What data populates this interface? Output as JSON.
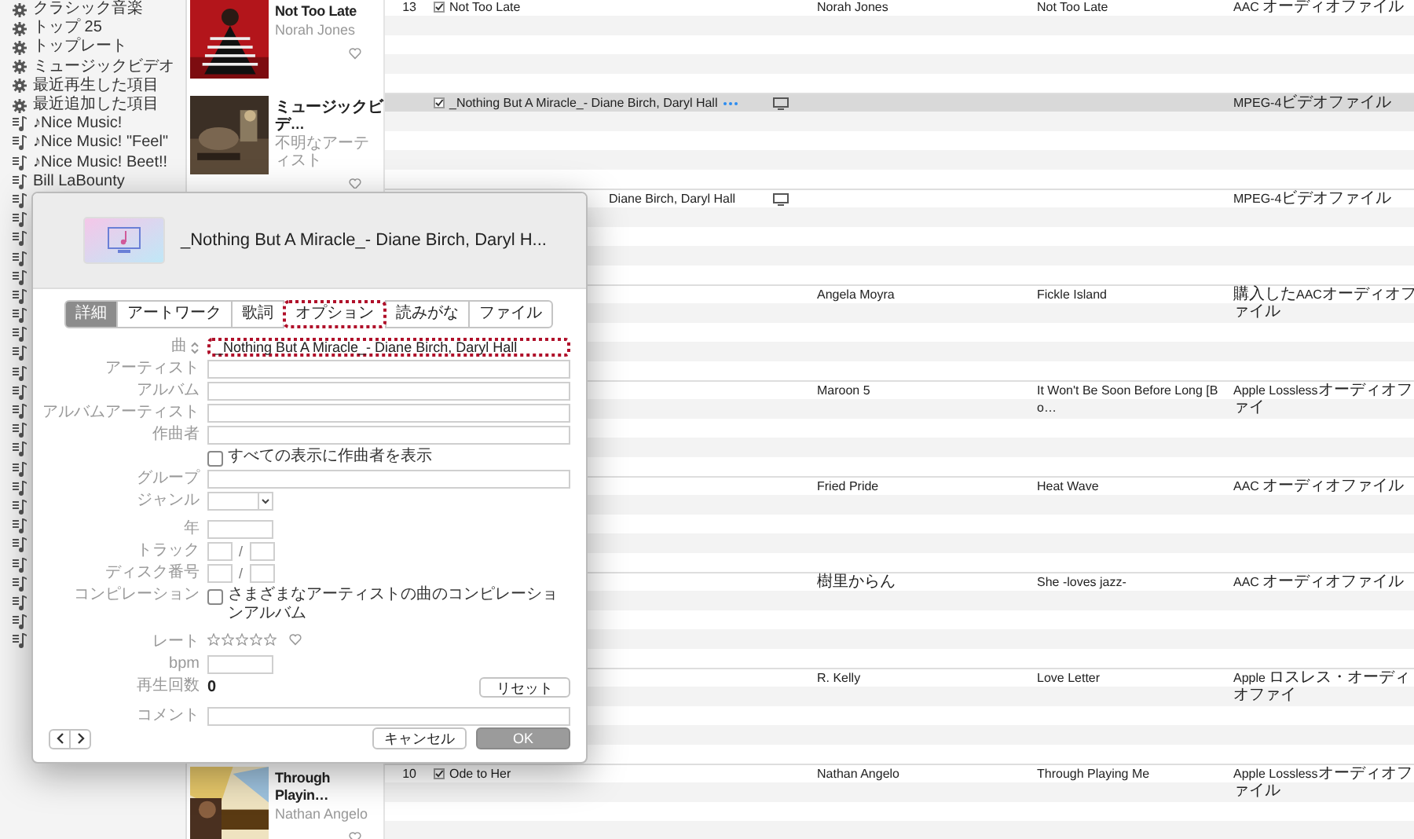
{
  "sidebar": {
    "items": [
      {
        "kind": "smart",
        "label": "クラシック音楽"
      },
      {
        "kind": "smart",
        "label": "トップ 25"
      },
      {
        "kind": "smart",
        "label": "トップレート"
      },
      {
        "kind": "smart",
        "label": "ミュージックビデオ"
      },
      {
        "kind": "smart",
        "label": "最近再生した項目"
      },
      {
        "kind": "smart",
        "label": "最近追加した項目"
      },
      {
        "kind": "playlist",
        "label": "♪Nice Music!"
      },
      {
        "kind": "playlist",
        "label": "♪Nice Music! \"Feel\""
      },
      {
        "kind": "playlist",
        "label": "♪Nice Music! Beet!!"
      },
      {
        "kind": "playlist",
        "label": "Bill LaBounty"
      },
      {
        "kind": "playlist"
      },
      {
        "kind": "playlist"
      },
      {
        "kind": "playlist"
      },
      {
        "kind": "playlist"
      },
      {
        "kind": "playlist"
      },
      {
        "kind": "playlist"
      },
      {
        "kind": "playlist"
      },
      {
        "kind": "playlist"
      },
      {
        "kind": "playlist"
      },
      {
        "kind": "playlist"
      },
      {
        "kind": "playlist"
      },
      {
        "kind": "playlist"
      },
      {
        "kind": "playlist"
      },
      {
        "kind": "playlist"
      },
      {
        "kind": "playlist"
      },
      {
        "kind": "playlist"
      },
      {
        "kind": "playlist"
      },
      {
        "kind": "playlist"
      },
      {
        "kind": "playlist"
      },
      {
        "kind": "playlist"
      },
      {
        "kind": "playlist"
      },
      {
        "kind": "playlist"
      },
      {
        "kind": "playlist"
      },
      {
        "kind": "playlist"
      }
    ]
  },
  "library": {
    "groups": [
      {
        "album": {
          "title": "Not Too Late",
          "artist": "Norah Jones"
        },
        "number": "13",
        "checked": true,
        "title": "Not Too Late",
        "artist": "Norah Jones",
        "album_name": "Not Too Late",
        "file_kind": "AAC オーディオファイル",
        "selected": false
      },
      {
        "album": {
          "title": "ミュージックビデ…",
          "artist": "不明なアーティスト"
        },
        "checked": true,
        "title": "_Nothing But A Miracle_- Diane Birch, Daryl Hall",
        "more": true,
        "video": true,
        "file_kind": "MPEG-4ビデオファイル",
        "selected": true
      },
      {
        "title": "Diane Birch, Daryl Hall",
        "partly_hidden": true,
        "video": true,
        "file_kind": "MPEG-4ビデオファイル",
        "selected": false
      },
      {
        "artist": "Angela Moyra",
        "album_name": "Fickle Island",
        "file_kind": "購入したAACオーディオファイル",
        "selected": false
      },
      {
        "artist": "Maroon 5",
        "album_name": "It Won't Be Soon Before Long [Bo…",
        "file_kind": "Apple Losslessオーディオファイ",
        "selected": false
      },
      {
        "artist": "Fried Pride",
        "album_name": "Heat Wave",
        "file_kind": "AAC オーディオファイル",
        "selected": false
      },
      {
        "artist": "樹里からん",
        "album_name": "She -loves jazz-",
        "file_kind": "AAC オーディオファイル",
        "selected": false
      },
      {
        "artist": "R. Kelly",
        "album_name": "Love Letter",
        "file_kind": "Apple ロスレス・オーディオファイ",
        "selected": false
      },
      {
        "album": {
          "title": "Through Playin…",
          "artist": "Nathan Angelo"
        },
        "number": "10",
        "checked": true,
        "title": "Ode to Her",
        "artist": "Nathan Angelo",
        "album_name": "Through Playing Me",
        "file_kind": "Apple Losslessオーディオファイル",
        "selected": false
      }
    ]
  },
  "dialog": {
    "title": "_Nothing But A Miracle_- Diane Birch, Daryl H...",
    "tabs": [
      {
        "label": "詳細",
        "selected": true,
        "highlighted": false
      },
      {
        "label": "アートワーク",
        "selected": false,
        "highlighted": false
      },
      {
        "label": "歌詞",
        "selected": false,
        "highlighted": false
      },
      {
        "label": "オプション",
        "selected": false,
        "highlighted": true
      },
      {
        "label": "読みがな",
        "selected": false,
        "highlighted": false
      },
      {
        "label": "ファイル",
        "selected": false,
        "highlighted": false
      }
    ],
    "sections": [
      [
        {
          "kind": "text",
          "label": "曲",
          "sort_icon": true,
          "value": "_Nothing But A Miracle_- Diane Birch, Daryl Hall",
          "highlighted": true
        },
        {
          "kind": "text",
          "label": "アーティスト"
        },
        {
          "kind": "text",
          "label": "アルバム"
        },
        {
          "kind": "text",
          "label": "アルバムアーティスト"
        },
        {
          "kind": "text",
          "label": "作曲者"
        },
        {
          "kind": "checkbox",
          "text": "すべての表示に作曲者を表示",
          "checked": false
        },
        {
          "kind": "text",
          "label": "グループ"
        },
        {
          "kind": "select",
          "label": "ジャンル"
        }
      ],
      [
        {
          "kind": "short",
          "label": "年"
        },
        {
          "kind": "pair",
          "label": "トラック",
          "separator": "/"
        },
        {
          "kind": "pair",
          "label": "ディスク番号",
          "separator": "/"
        },
        {
          "kind": "checkbox",
          "label": "コンピレーション",
          "text": "さまざまなアーティストの曲のコンピレーションアルバム",
          "checked": false
        }
      ],
      [
        {
          "kind": "rating",
          "label": "レート",
          "stars": 0
        },
        {
          "kind": "short",
          "label": "bpm"
        },
        {
          "kind": "count",
          "label": "再生回数",
          "value": "0",
          "button": "リセット"
        }
      ],
      [
        {
          "kind": "text",
          "label": "コメント"
        }
      ]
    ],
    "buttons": [
      {
        "label": "キャンセル",
        "kind": "cancel"
      },
      {
        "label": "OK",
        "kind": "default"
      }
    ]
  }
}
